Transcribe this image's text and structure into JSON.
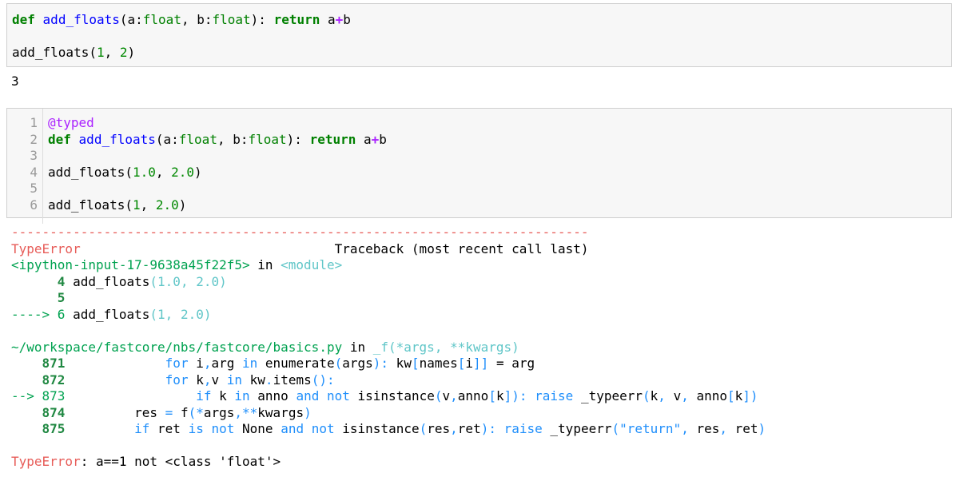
{
  "cell1": {
    "line1": {
      "def": "def",
      "name": "add_floats",
      "open": "(a:",
      "t1": "float",
      "mid": ", b:",
      "t2": "float",
      "close": "): ",
      "ret": "return",
      "a": " a",
      "plus": "+",
      "b": "b"
    },
    "line3": {
      "name": "add_floats(",
      "n1": "1",
      "sep": ", ",
      "n2": "2",
      "close": ")"
    }
  },
  "output": "3",
  "cell2": {
    "line_numbers": [
      "1",
      "2",
      "3",
      "4",
      "5",
      "6"
    ],
    "decorator": "@typed",
    "line2": {
      "def": "def",
      "name": "add_floats",
      "open": "(a:",
      "t1": "float",
      "mid": ", b:",
      "t2": "float",
      "close": "): ",
      "ret": "return",
      "a": " a",
      "plus": "+",
      "b": "b"
    },
    "line4": {
      "name": "add_floats(",
      "n1": "1.0",
      "sep": ", ",
      "n2": "2.0",
      "close": ")"
    },
    "line6": {
      "name": "add_floats(",
      "n1": "1",
      "sep": ", ",
      "n2": "2.0",
      "close": ")"
    }
  },
  "traceback": {
    "dashes": "---------------------------------------------------------------------------",
    "error_type": "TypeError",
    "header_gap": "                                 ",
    "header": "Traceback (most recent call last)",
    "frame1": {
      "file": "<ipython-input-17-9638a45f22f5>",
      "in": " in ",
      "func": "<module>",
      "l4_num": "      4",
      "l4_code": " add_floats",
      "l4_args": "(1.0, 2.0)",
      "l5_num": "      5",
      "arrow": "----> 6",
      "l6_code": " add_floats",
      "l6_args": "(1, 2.0)"
    },
    "frame2": {
      "file": "~/workspace/fastcore/nbs/fastcore/basics.py",
      "in": " in ",
      "func": "_f(*args, **kwargs)",
      "l871_num": "    871",
      "l871": {
        "p1": "             ",
        "for": "for",
        "p2": " i",
        "c1": ",",
        "p3": "arg ",
        "in": "in",
        "p4": " enumerate",
        "o1": "(",
        "p5": "args",
        "o2": "):",
        "p6": " kw",
        "o3": "[",
        "p7": "names",
        "o4": "[",
        "p8": "i",
        "o5": "]]",
        "p9": " = arg"
      },
      "l872_num": "    872",
      "l872": {
        "p1": "             ",
        "for": "for",
        "p2": " k",
        "c1": ",",
        "p3": "v ",
        "in": "in",
        "p4": " kw",
        "o1": ".",
        "p5": "items",
        "o2": "():"
      },
      "arrow873": "--> 873",
      "l873": {
        "p1": "                 ",
        "if": "if",
        "p2": " k ",
        "in": "in",
        "p3": " anno ",
        "and": "and",
        "sp": " ",
        "not": "not",
        "p4": " isinstance",
        "o1": "(",
        "p5": "v",
        "c1": ",",
        "p6": "anno",
        "o2": "[",
        "p7": "k",
        "o3": "]):",
        "sp2": " ",
        "raise": "raise",
        "p8": " _typeerr",
        "o4": "(",
        "p9": "k",
        "c2": ",",
        "p10": " v",
        "c3": ",",
        "p11": " anno",
        "o5": "[",
        "p12": "k",
        "o6": "])"
      },
      "l874_num": "    874",
      "l874": {
        "p1": "         res ",
        "eq": "=",
        "p2": " f",
        "o1": "(*",
        "p3": "args",
        "o2": ",**",
        "p4": "kwargs",
        "o3": ")"
      },
      "l875_num": "    875",
      "l875": {
        "p1": "         ",
        "if": "if",
        "p2": " ret ",
        "is": "is",
        "sp": " ",
        "not": "not",
        "p3": " None ",
        "and": "and",
        "sp2": " ",
        "not2": "not",
        "p4": " isinstance",
        "o1": "(",
        "p5": "res",
        "c1": ",",
        "p6": "ret",
        "o2": "):",
        "sp3": " ",
        "raise": "raise",
        "p7": " _typeerr",
        "o3": "(",
        "str": "\"return\"",
        "c2": ",",
        "p8": " res",
        "c3": ",",
        "p9": " ret",
        "o4": ")"
      }
    },
    "final_type": "TypeError",
    "final_msg": ": a==1 not <class 'float'>"
  }
}
